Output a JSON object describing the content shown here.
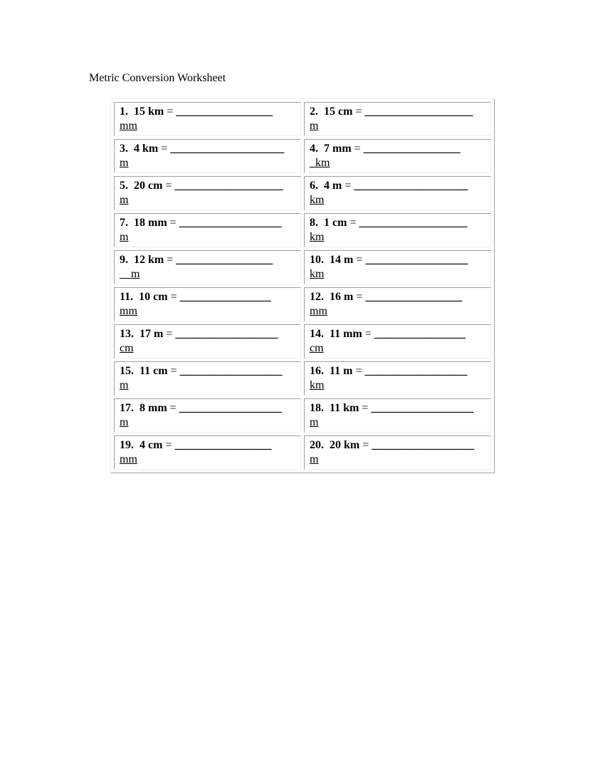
{
  "title": "Metric Conversion Worksheet",
  "problems": [
    {
      "num": "1.",
      "value": "15 km",
      "eq": "=",
      "blank": "_________________",
      "target": "mm"
    },
    {
      "num": "2.",
      "value": "15 cm",
      "eq": "=",
      "blank": "___________________",
      "target": "m"
    },
    {
      "num": "3.",
      "value": "4 km",
      "eq": "=",
      "blank": "____________________",
      "target": "m"
    },
    {
      "num": "4.",
      "value": "7 mm",
      "eq": "=",
      "blank": "_________________",
      "target": "_km"
    },
    {
      "num": "5.",
      "value": "20 cm",
      "eq": "=",
      "blank": "___________________",
      "target": "m"
    },
    {
      "num": "6.",
      "value": "4 m",
      "eq": "=",
      "blank": "____________________",
      "target": "km"
    },
    {
      "num": "7.",
      "value": "18 mm",
      "eq": "=",
      "blank": "__________________",
      "target": "m"
    },
    {
      "num": "8.",
      "value": "1 cm",
      "eq": "=",
      "blank": "___________________",
      "target": "km"
    },
    {
      "num": "9.",
      "value": "12 km",
      "eq": "=",
      "blank": "_________________",
      "target": "__m"
    },
    {
      "num": "10.",
      "value": "14 m",
      "eq": "=",
      "blank": "__________________",
      "target": "km"
    },
    {
      "num": "11.",
      "value": "10 cm",
      "eq": "=",
      "blank": "________________",
      "target": "mm"
    },
    {
      "num": "12.",
      "value": "16 m",
      "eq": "=",
      "blank": "_________________",
      "target": "mm"
    },
    {
      "num": "13.",
      "value": "17 m",
      "eq": "=",
      "blank": "__________________",
      "target": "cm"
    },
    {
      "num": "14.",
      "value": "11 mm",
      "eq": "=",
      "blank": "________________",
      "target": "cm"
    },
    {
      "num": "15.",
      "value": "11 cm",
      "eq": "=",
      "blank": "__________________",
      "target": "m"
    },
    {
      "num": "16.",
      "value": "11 m",
      "eq": "=",
      "blank": "__________________",
      "target": "km"
    },
    {
      "num": "17.",
      "value": "8 mm",
      "eq": "=",
      "blank": "__________________",
      "target": "m"
    },
    {
      "num": "18.",
      "value": "11 km",
      "eq": "=",
      "blank": "__________________",
      "target": "m"
    },
    {
      "num": "19.",
      "value": "4 cm",
      "eq": "=",
      "blank": "_________________",
      "target": "mm"
    },
    {
      "num": "20.",
      "value": "20 km",
      "eq": "=",
      "blank": "__________________",
      "target": "m"
    }
  ]
}
